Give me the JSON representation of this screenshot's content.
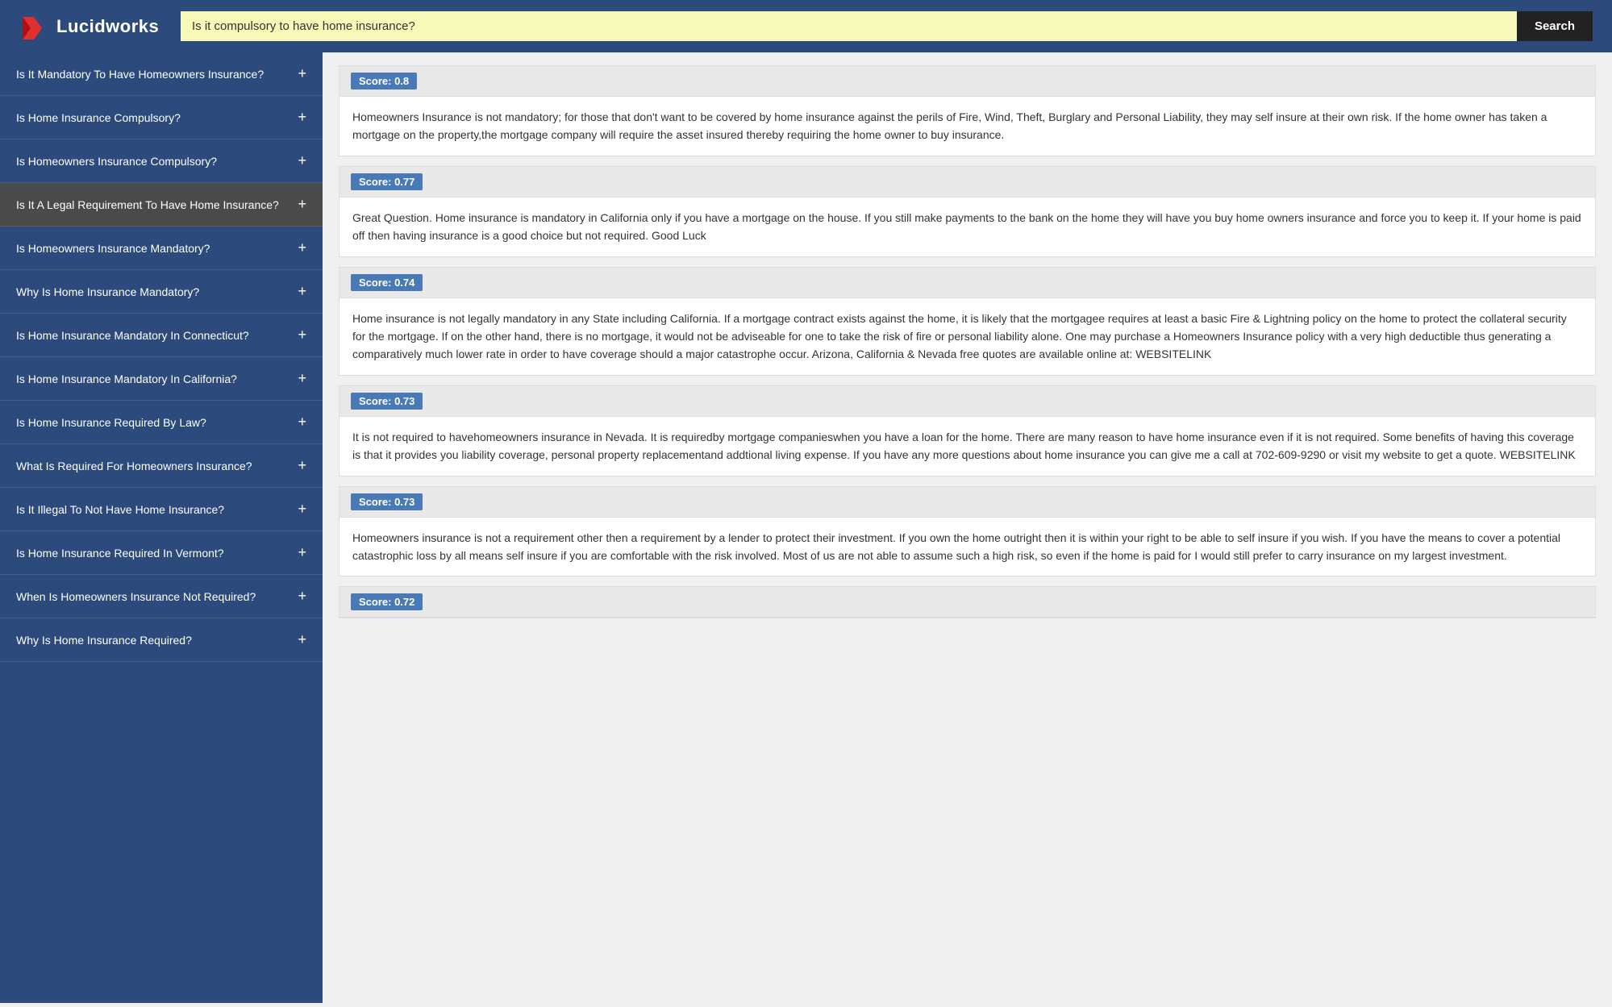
{
  "header": {
    "logo_text": "Lucidworks",
    "search_value": "Is it compulsory to have home insurance?",
    "search_button_label": "Search"
  },
  "sidebar": {
    "items": [
      {
        "label": "Is It Mandatory To Have Homeowners Insurance?",
        "active": false
      },
      {
        "label": "Is Home Insurance Compulsory?",
        "active": false
      },
      {
        "label": "Is Homeowners Insurance Compulsory?",
        "active": false
      },
      {
        "label": "Is It A Legal Requirement To Have Home Insurance?",
        "active": true
      },
      {
        "label": "Is Homeowners Insurance Mandatory?",
        "active": false
      },
      {
        "label": "Why Is Home Insurance Mandatory?",
        "active": false
      },
      {
        "label": "Is Home Insurance Mandatory In Connecticut?",
        "active": false
      },
      {
        "label": "Is Home Insurance Mandatory In California?",
        "active": false
      },
      {
        "label": "Is Home Insurance Required By Law?",
        "active": false
      },
      {
        "label": "What Is Required For Homeowners Insurance?",
        "active": false
      },
      {
        "label": "Is It Illegal To Not Have Home Insurance?",
        "active": false
      },
      {
        "label": "Is Home Insurance Required In Vermont?",
        "active": false
      },
      {
        "label": "When Is Homeowners Insurance Not Required?",
        "active": false
      },
      {
        "label": "Why Is Home Insurance Required?",
        "active": false
      }
    ]
  },
  "results": [
    {
      "score": "Score: 0.8",
      "text": "Homeowners Insurance is not mandatory; for those that don't want to be covered by home insurance against the perils of Fire, Wind, Theft, Burglary and Personal Liability, they may self insure at their own risk. If the home owner has taken a mortgage on the property,the mortgage company will require the asset insured thereby requiring the home owner to buy insurance."
    },
    {
      "score": "Score: 0.77",
      "text": "Great Question. Home insurance is mandatory in California only if you have a mortgage on the house. If you still make payments to the bank on the home they will have you buy home owners insurance and force you to keep it. If your home is paid off then having insurance is a good choice but not required. Good Luck"
    },
    {
      "score": "Score: 0.74",
      "text": "Home insurance is not legally mandatory in any State including California. If a mortgage contract exists against the home, it is likely that the mortgagee requires at least a basic Fire & Lightning policy on the home to protect the collateral security for the mortgage. If on the other hand, there is no mortgage, it would not be adviseable for one to take the risk of fire or personal liability alone. One may purchase a Homeowners Insurance policy with a very high deductible thus generating a comparatively much lower rate in order to have coverage should a major catastrophe occur. Arizona, California & Nevada free quotes are available online at: WEBSITELINK"
    },
    {
      "score": "Score: 0.73",
      "text": "It is not required to havehomeowners insurance in Nevada. It is requiredby mortgage companieswhen you have a loan for the home. There are many reason to have home insurance even if it is not required. Some benefits of having this coverage is that it provides you liability coverage, personal property replacementand addtional living expense. If you have any more questions about home insurance you can give me a call at 702-609-9290 or visit my website to get a quote. WEBSITELINK"
    },
    {
      "score": "Score: 0.73",
      "text": "Homeowners insurance is not a requirement other then a requirement by a lender to protect their investment. If you own the home outright then it is within your right to be able to self insure if you wish. If you have the means to cover a potential catastrophic loss by all means self insure if you are comfortable with the risk involved. Most of us are not able to assume such a high risk, so even if the home is paid for I would still prefer to carry insurance on my largest investment."
    },
    {
      "score": "Score: 0.72",
      "text": ""
    }
  ]
}
